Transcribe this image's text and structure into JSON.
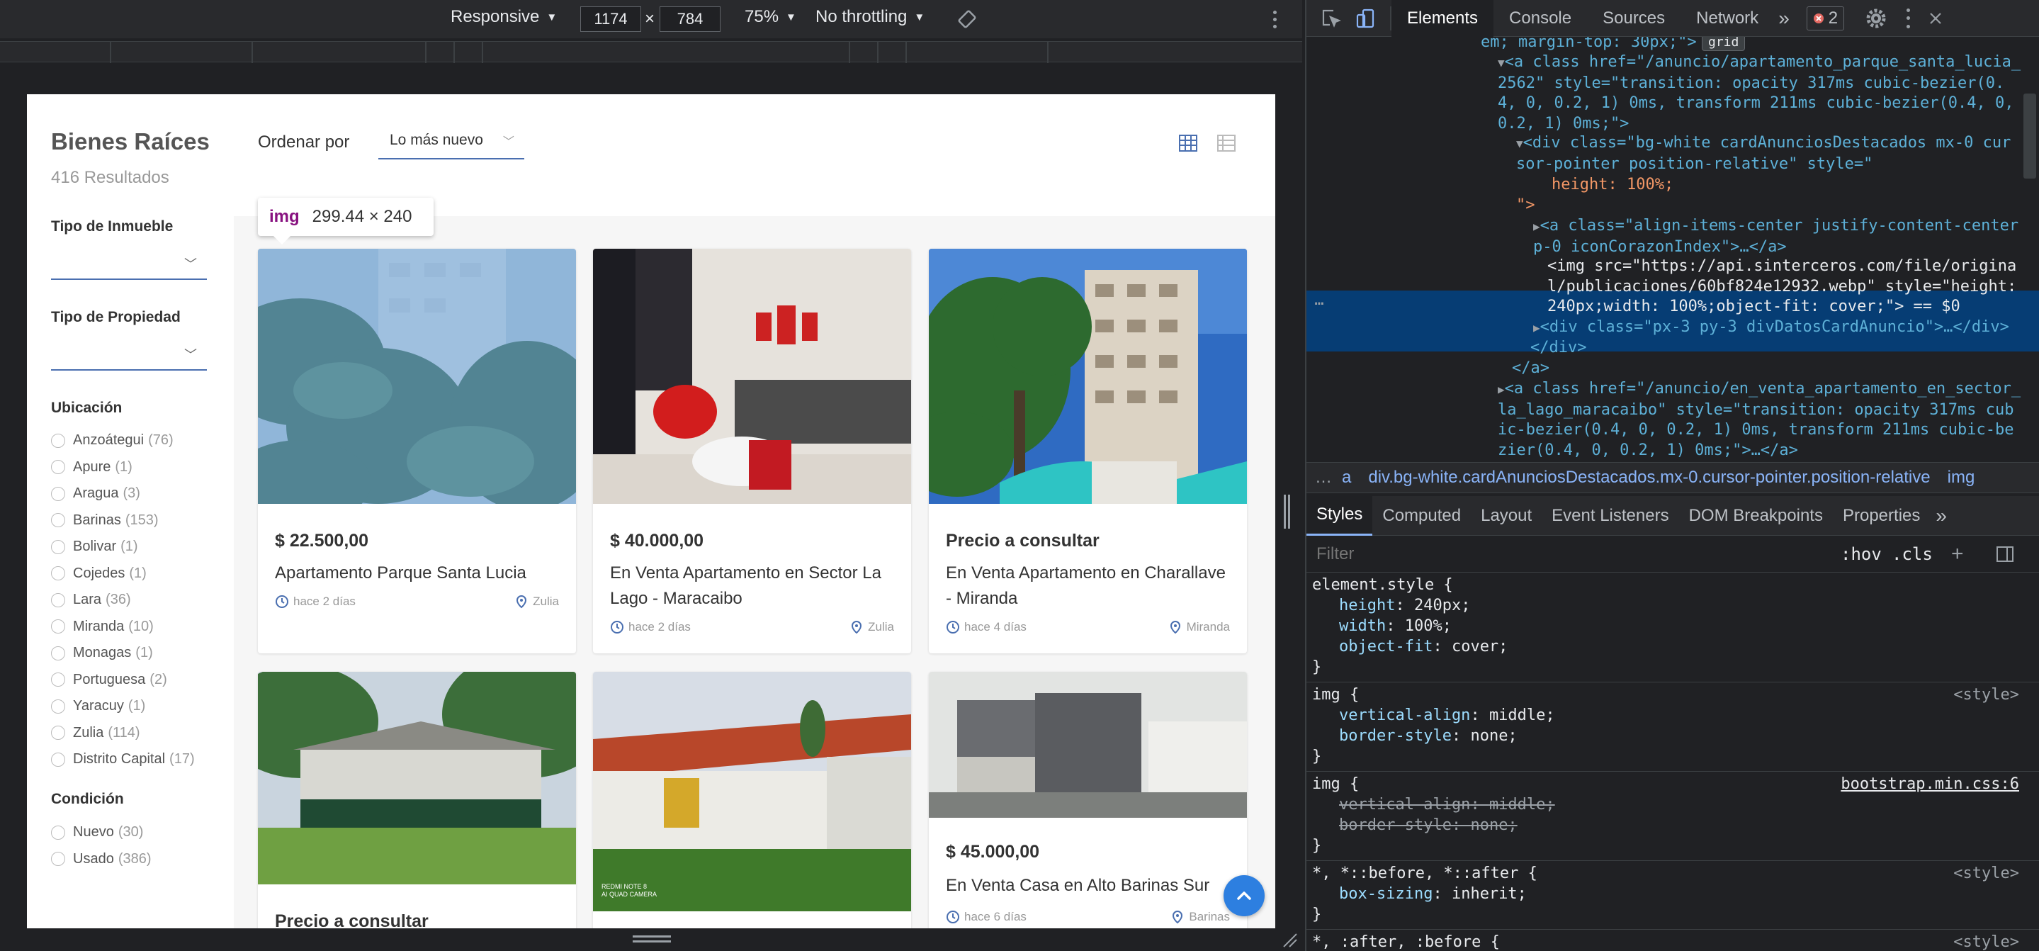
{
  "devbar": {
    "mode": "Responsive",
    "width": "1174",
    "height": "784",
    "zoom": "75%",
    "throttle": "No throttling",
    "times": "×"
  },
  "page": {
    "brand": "Bienes Raíces",
    "results": "416 Resultados",
    "sort_label": "Ordenar por",
    "sort_value": "Lo más nuevo",
    "filters": {
      "tipo_inmueble": "Tipo de Inmueble",
      "tipo_propiedad": "Tipo de Propiedad",
      "ubicacion": "Ubicación",
      "locations": [
        {
          "name": "Anzoátegui",
          "count": "(76)"
        },
        {
          "name": "Apure",
          "count": "(1)"
        },
        {
          "name": "Aragua",
          "count": "(3)"
        },
        {
          "name": "Barinas",
          "count": "(153)"
        },
        {
          "name": "Bolivar",
          "count": "(1)"
        },
        {
          "name": "Cojedes",
          "count": "(1)"
        },
        {
          "name": "Lara",
          "count": "(36)"
        },
        {
          "name": "Miranda",
          "count": "(10)"
        },
        {
          "name": "Monagas",
          "count": "(1)"
        },
        {
          "name": "Portuguesa",
          "count": "(2)"
        },
        {
          "name": "Yaracuy",
          "count": "(1)"
        },
        {
          "name": "Zulia",
          "count": "(114)"
        },
        {
          "name": "Distrito Capital",
          "count": "(17)"
        }
      ],
      "condicion": "Condición",
      "conditions": [
        {
          "name": "Nuevo",
          "count": "(30)"
        },
        {
          "name": "Usado",
          "count": "(386)"
        }
      ]
    },
    "tooltip": {
      "tag": "img",
      "size": "299.44 × 240"
    },
    "cards": [
      {
        "price": "$ 22.500,00",
        "title": "Apartamento Parque Santa Lucia",
        "time": "hace 2 días",
        "location": "Zulia"
      },
      {
        "price": "$ 40.000,00",
        "title": "En Venta Apartamento en Sector La Lago - Maracaibo",
        "time": "hace 2 días",
        "location": "Zulia"
      },
      {
        "price": "Precio a consultar",
        "title": "En Venta Apartamento en Charallave - Miranda",
        "time": "hace 4 días",
        "location": "Miranda"
      },
      {
        "price": "Precio a consultar"
      },
      {
        "price": "$ 45.000,00",
        "title": "En Venta Casa en Alto Barinas Sur",
        "time": "hace 6 días",
        "location": "Barinas"
      }
    ],
    "watermark": "REDMI NOTE 8\nAI QUAD CAMERA"
  },
  "devtools": {
    "tabs": [
      "Elements",
      "Console",
      "Sources",
      "Network"
    ],
    "more": "»",
    "error_count": "2",
    "dom_lines": [
      "em; margin-top: 30px;\">",
      "grid",
      "<a class href=\"/anuncio/apartamento_parque_santa_lucia_2562\" style=\"transition: opacity 317ms cubic-bezier(0.4, 0, 0.2, 1) 0ms, transform 211ms cubic-bezier(0.4, 0, 0.2, 1) 0ms;\">",
      "<div class=\"bg-white cardAnunciosDestacados mx-0 cursor-pointer position-relative\" style=\"",
      "height: 100%;",
      "\">",
      "<a class=\"align-items-center justify-content-center p-0 iconCorazonIndex\">…</a>",
      "<img src=\"https://api.sinterceros.com/file/original/publicaciones/60bf824e12932.webp\" style=\"height: 240px;width: 100%;object-fit: cover;\"> == $0",
      "<div class=\"px-3 py-3 divDatosCardAnuncio\">…</div>",
      "</div>",
      "</a>",
      "<a class href=\"/anuncio/en_venta_apartamento_en_sector_la_lago_maracaibo\" style=\"transition: opacity 317ms cubic-bezier(0.4, 0, 0.2, 1) 0ms, transform 211ms cubic-bezier(0.4, 0, 0.2, 1) 0ms;\">…</a>"
    ],
    "breadcrumb": [
      "a",
      "div.bg-white.cardAnunciosDestacados.mx-0.cursor-pointer.position-relative",
      "img"
    ],
    "style_tabs": [
      "Styles",
      "Computed",
      "Layout",
      "Event Listeners",
      "DOM Breakpoints",
      "Properties"
    ],
    "filter_placeholder": "Filter",
    "hov": ":hov",
    "cls": ".cls",
    "rules": [
      {
        "selector": "element.style {",
        "source": "",
        "props": [
          [
            "height",
            "240px;"
          ],
          [
            "width",
            "100%;"
          ],
          [
            "object-fit",
            "cover;"
          ]
        ]
      },
      {
        "selector": "img {",
        "source": "<style>",
        "props": [
          [
            "vertical-align",
            "middle;"
          ],
          [
            "border-style",
            "none;"
          ]
        ]
      },
      {
        "selector": "img {",
        "source": "bootstrap.min.css:6",
        "props": [
          [
            "vertical-align",
            "middle;"
          ],
          [
            "border-style",
            "none;"
          ]
        ]
      },
      {
        "selector": "*, *::before, *::after {",
        "source": "<style>",
        "props": [
          [
            "box-sizing",
            "inherit;"
          ]
        ]
      },
      {
        "selector": "*, :after, :before {",
        "source": "<style>",
        "props": []
      }
    ]
  }
}
